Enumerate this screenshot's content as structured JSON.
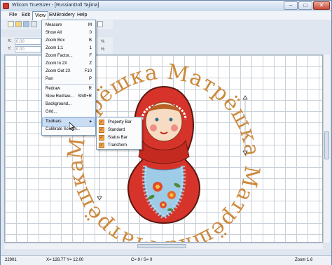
{
  "window": {
    "title": "Wilcom TrueSizer - [RussianDoll     Tajima]",
    "controls": {
      "minimize": "–",
      "maximize": "□",
      "close": "✕"
    }
  },
  "menubar": {
    "items": [
      {
        "label": "File"
      },
      {
        "label": "Edit"
      },
      {
        "label": "View"
      },
      {
        "label": "EMBroidery"
      },
      {
        "label": "Help"
      }
    ]
  },
  "property_bar": {
    "x_label": "X:",
    "y_label": "Y:",
    "x_value": "0.00",
    "y_value": "0.00",
    "percent_1": "%",
    "percent_2": "%"
  },
  "view_menu": {
    "items": [
      {
        "label": "Measure",
        "shortcut": "M"
      },
      {
        "label": "Show All",
        "shortcut": "0"
      },
      {
        "label": "Zoom Box",
        "shortcut": "B"
      },
      {
        "label": "Zoom 1:1",
        "shortcut": "1"
      },
      {
        "label": "Zoom Factor...",
        "shortcut": "F"
      },
      {
        "label": "Zoom In 2X",
        "shortcut": "Z"
      },
      {
        "label": "Zoom Out 2X",
        "shortcut": "F10"
      },
      {
        "label": "Pan",
        "shortcut": "P"
      },
      {
        "label": "Redraw",
        "shortcut": "R"
      },
      {
        "label": "Slow Redraw...",
        "shortcut": "Shift+R"
      },
      {
        "label": "Background...",
        "shortcut": ""
      },
      {
        "label": "Grid...",
        "shortcut": ""
      },
      {
        "label": "Toolbars",
        "shortcut": "▸"
      },
      {
        "label": "Calibrate Screen...",
        "shortcut": ""
      }
    ]
  },
  "toolbars_submenu": {
    "items": [
      {
        "label": "Property Bar",
        "checked": true
      },
      {
        "label": "Standard",
        "checked": true
      },
      {
        "label": "Status Bar",
        "checked": true
      },
      {
        "label": "Transform",
        "checked": true
      }
    ]
  },
  "canvas": {
    "ring_text": "Матрёшка Матрёшка Матрёшка Матрёшка",
    "ring_color": "#cc8a3e"
  },
  "statusbar": {
    "stitches": "22901",
    "coords": "X= 128.77 Y= 12.00",
    "color": "C= 9 / S= 0",
    "zoom": "Zoom 1.6"
  },
  "colors": {
    "accent": "#c9def5",
    "doll_red": "#d6342a",
    "doll_blue": "#7fb6d8",
    "check_orange": "#f3a54a"
  },
  "icons": [
    "app-icon",
    "new-icon",
    "open-icon",
    "save-icon",
    "print-icon",
    "check-icon",
    "cursor-icon"
  ]
}
